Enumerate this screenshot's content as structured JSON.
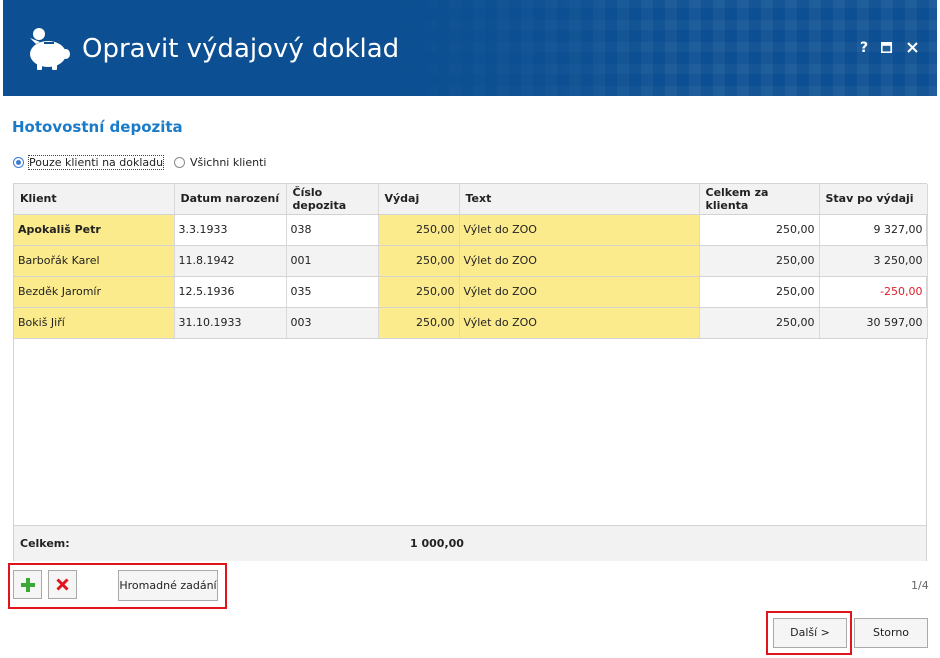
{
  "window": {
    "title": "Opravit výdajový doklad",
    "help_label": "?",
    "maximize_label": "□",
    "close_label": "✕",
    "logo_icon": "piggy-bank-icon"
  },
  "section": {
    "title": "Hotovostní depozita"
  },
  "filter": {
    "option_selected": "Pouze klienti na dokladu",
    "option_all": "Všichni klienti"
  },
  "grid": {
    "columns": [
      "Klient",
      "Datum narození",
      "Číslo depozita",
      "Výdaj",
      "Text",
      "Celkem za klienta",
      "Stav po výdaji"
    ],
    "rows": [
      {
        "klient": "Apokališ Petr",
        "datum": "3.3.1933",
        "cislo": "038",
        "vydaj": "250,00",
        "text": "Výlet do ZOO",
        "celkem": "250,00",
        "stav": "9 327,00"
      },
      {
        "klient": "Barbořák Karel",
        "datum": "11.8.1942",
        "cislo": "001",
        "vydaj": "250,00",
        "text": "Výlet do ZOO",
        "celkem": "250,00",
        "stav": "3 250,00"
      },
      {
        "klient": "Bezděk Jaromír",
        "datum": "12.5.1936",
        "cislo": "035",
        "vydaj": "250,00",
        "text": "Výlet do ZOO",
        "celkem": "250,00",
        "stav": "-250,00"
      },
      {
        "klient": "Bokiš Jiří",
        "datum": "31.10.1933",
        "cislo": "003",
        "vydaj": "250,00",
        "text": "Výlet do ZOO",
        "celkem": "250,00",
        "stav": "30 597,00"
      }
    ],
    "footer_label": "Celkem:",
    "footer_total": "1 000,00"
  },
  "toolbar": {
    "add_icon": "plus-icon",
    "delete_icon": "x-icon",
    "bulk_label": "Hromadné zadání"
  },
  "pager": {
    "text": "1/4"
  },
  "actions": {
    "next_label": "Další >",
    "cancel_label": "Storno"
  },
  "colors": {
    "header": "#0c4f92",
    "accent": "#1a7bc9",
    "highlight": "#fbeb8c",
    "negative": "#e0202a",
    "marker": "#e0141c"
  }
}
